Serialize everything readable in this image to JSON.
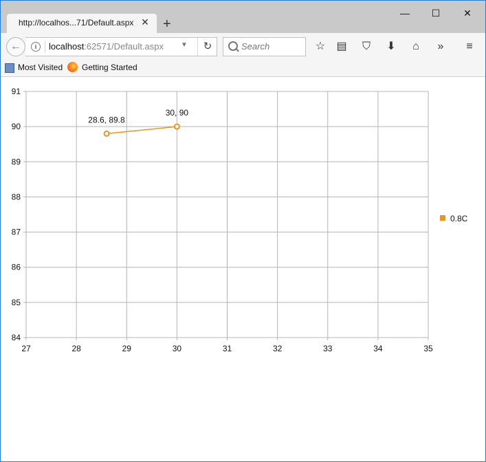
{
  "browser": {
    "tab_title": "http://localhos...71/Default.aspx",
    "url_host": "localhost",
    "url_rest": ":62571/Default.aspx",
    "search_placeholder": "Search",
    "bookmarks": [
      "Most Visited",
      "Getting Started"
    ]
  },
  "chart_data": {
    "type": "scatter",
    "xlim": [
      27,
      35
    ],
    "ylim": [
      84,
      91
    ],
    "x_ticks": [
      "27",
      "28",
      "29",
      "30",
      "31",
      "32",
      "33",
      "34",
      "35"
    ],
    "y_ticks": [
      "84",
      "85",
      "86",
      "87",
      "88",
      "89",
      "90",
      "91"
    ],
    "grid": true,
    "legend_placement": "right",
    "series": [
      {
        "name": "0.8C",
        "color": "#f0921e",
        "points": [
          {
            "x": 28.6,
            "y": 89.8,
            "label": "28.6, 89.8"
          },
          {
            "x": 30,
            "y": 90,
            "label": "30, 90"
          }
        ]
      }
    ]
  }
}
